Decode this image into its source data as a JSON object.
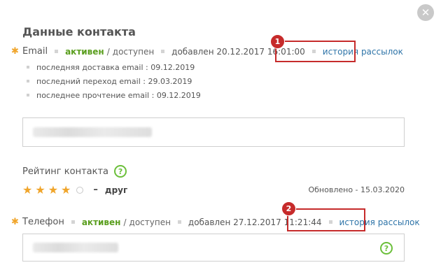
{
  "title": "Данные контакта",
  "email_row": {
    "label": "Email",
    "status_active": "активен",
    "status_sep": "/",
    "status_available": "доступен",
    "added": "добавлен 20.12.2017 16:01:00",
    "history_link": "история рассылок"
  },
  "email_details": [
    "последняя доставка email : 09.12.2019",
    "последний переход email : 29.03.2019",
    "последнее прочтение email : 09.12.2019"
  ],
  "rating": {
    "label": "Рейтинг контакта",
    "help": "?",
    "stars_filled": 4,
    "stars_total": 5,
    "dash": "–",
    "value_label": "друг",
    "updated": "Обновлено - 15.03.2020"
  },
  "phone_row": {
    "label": "Телефон",
    "status_active": "активен",
    "status_sep": "/",
    "status_available": "доступен",
    "added": "добавлен 27.12.2017 11:21:44",
    "history_link": "история рассылок",
    "help": "?"
  },
  "annotations": [
    "1",
    "2"
  ],
  "close_symbol": "✕",
  "colors": {
    "accent_green": "#5a9e1e",
    "link_blue": "#2e74a8",
    "highlight_red": "#c62b2b",
    "star_orange": "#f0a52b"
  }
}
